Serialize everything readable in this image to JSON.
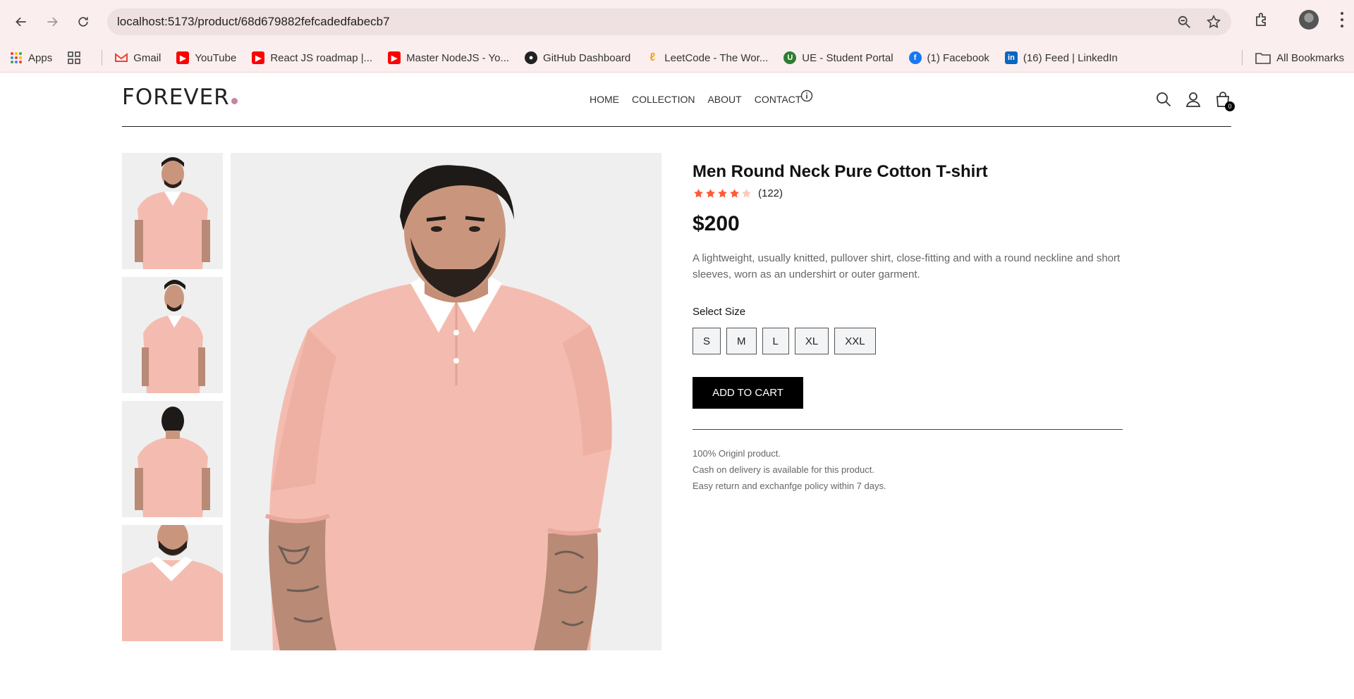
{
  "browser": {
    "url": "localhost:5173/product/68d679882fefcadedfabecb7"
  },
  "bookmarks": {
    "apps_label": "Apps",
    "items": [
      {
        "label": "Gmail",
        "icon": "gmail-icon",
        "color": "#ea4335"
      },
      {
        "label": "YouTube",
        "icon": "youtube-icon",
        "color": "#ff0000"
      },
      {
        "label": "React JS roadmap |...",
        "icon": "youtube-icon",
        "color": "#ff0000"
      },
      {
        "label": "Master NodeJS - Yo...",
        "icon": "youtube-icon",
        "color": "#ff0000"
      },
      {
        "label": "GitHub Dashboard",
        "icon": "github-icon",
        "color": "#222222"
      },
      {
        "label": "LeetCode - The Wor...",
        "icon": "leetcode-icon",
        "color": "#f89f1b"
      },
      {
        "label": "UE - Student Portal",
        "icon": "ue-icon",
        "color": "#2e7d32"
      },
      {
        "label": "(1) Facebook",
        "icon": "facebook-icon",
        "color": "#1877f2"
      },
      {
        "label": "(16) Feed | LinkedIn",
        "icon": "linkedin-icon",
        "color": "#0a66c2"
      }
    ],
    "all_label": "All Bookmarks"
  },
  "site": {
    "nav": [
      "HOME",
      "COLLECTION",
      "ABOUT",
      "CONTACT"
    ],
    "cart_count": "0",
    "logo_color_dot": "#c586a5"
  },
  "product": {
    "title": "Men Round Neck Pure Cotton T-shirt",
    "rating": 4,
    "rating_max": 5,
    "review_count": "(122)",
    "price": "$200",
    "description": "A lightweight, usually knitted, pullover shirt, close-fitting and with a round neckline and short sleeves, worn as an undershirt or outer garment.",
    "size_label": "Select Size",
    "sizes": [
      "S",
      "M",
      "L",
      "XL",
      "XXL"
    ],
    "add_to_cart": "ADD TO CART",
    "notes": [
      "100% Originl product.",
      "Cash on delivery is available for this product.",
      "Easy return and exchanfge policy within 7 days."
    ],
    "accent_star": "#ff5a36",
    "shirt_color": "#f4bcb0"
  }
}
